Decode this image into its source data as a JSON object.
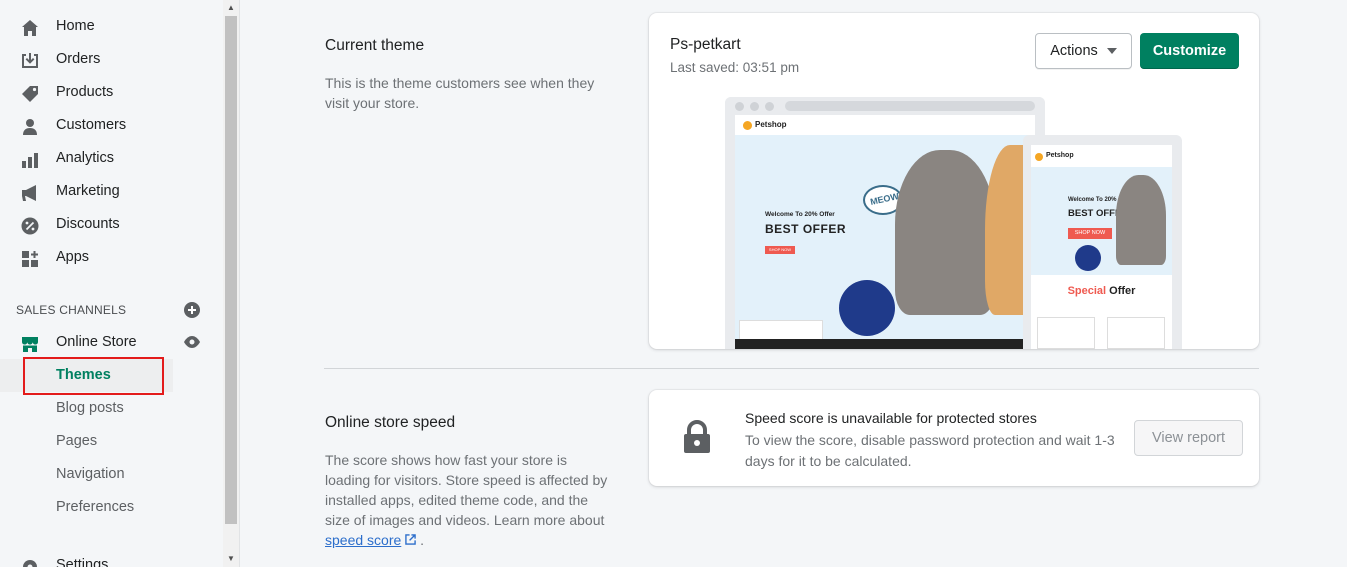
{
  "sidebar": {
    "items": [
      {
        "label": "Home",
        "icon": "home-icon"
      },
      {
        "label": "Orders",
        "icon": "orders-icon"
      },
      {
        "label": "Products",
        "icon": "tag-icon"
      },
      {
        "label": "Customers",
        "icon": "person-icon"
      },
      {
        "label": "Analytics",
        "icon": "bar-chart-icon"
      },
      {
        "label": "Marketing",
        "icon": "megaphone-icon"
      },
      {
        "label": "Discounts",
        "icon": "discount-icon"
      },
      {
        "label": "Apps",
        "icon": "apps-icon"
      }
    ],
    "sales_channels_title": "SALES CHANNELS",
    "online_store": "Online Store",
    "sub_items": [
      {
        "label": "Themes",
        "active": true
      },
      {
        "label": "Blog posts"
      },
      {
        "label": "Pages"
      },
      {
        "label": "Navigation"
      },
      {
        "label": "Preferences"
      }
    ],
    "settings": "Settings"
  },
  "current_theme": {
    "heading": "Current theme",
    "description": "This is the theme customers see when they visit your store.",
    "theme_name": "Ps-petkart",
    "last_saved": "Last saved: 03:51 pm",
    "actions_label": "Actions",
    "customize_label": "Customize"
  },
  "preview": {
    "brand": "Petshop",
    "welcome": "Welcome To 20% Offer",
    "best_offer": "BEST OFFER",
    "shop_now": "SHOP NOW",
    "meow": "MEOW",
    "special": "Special",
    "offer": "Offer"
  },
  "speed": {
    "heading": "Online store speed",
    "description": "The score shows how fast your store is loading for visitors. Store speed is affected by installed apps, edited theme code, and the size of images and videos. Learn more about",
    "link_text": "speed score",
    "link_suffix": " .",
    "card_title": "Speed score is unavailable for protected stores",
    "card_body": "To view the score, disable password protection and wait 1-3 days for it to be calculated.",
    "view_report": "View report"
  },
  "colors": {
    "primary": "#008060",
    "highlight": "#e31b1b",
    "link": "#2c6ecb"
  }
}
